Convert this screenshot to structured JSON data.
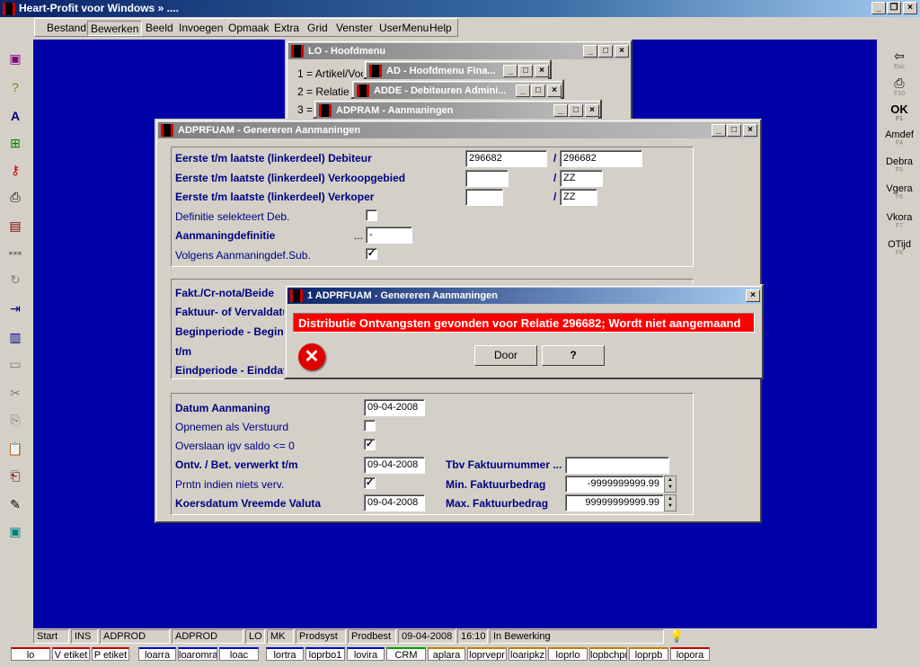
{
  "app": {
    "title": "Heart-Profit voor Windows",
    "title_suffix": "»  ...."
  },
  "menubar": {
    "items": [
      "Bestand",
      "Bewerken",
      "Beeld",
      "Invoegen",
      "Opmaak",
      "Extra",
      "Grid",
      "Venster",
      "UserMenu",
      "Help"
    ]
  },
  "right_toolbar": [
    {
      "label": "",
      "key": "Esc",
      "icon": "back-arrow-icon"
    },
    {
      "label": "",
      "key": "F10",
      "icon": "print-icon"
    },
    {
      "label": "OK",
      "key": "F1"
    },
    {
      "label": "Amdef",
      "key": "F4"
    },
    {
      "label": "Debra",
      "key": "F5"
    },
    {
      "label": "Vgera",
      "key": "F6"
    },
    {
      "label": "Vkora",
      "key": "F7"
    },
    {
      "label": "OTijd",
      "key": "F8"
    }
  ],
  "lo_window": {
    "title": "LO - Hoofdmenu",
    "items": [
      "1 = Artikel/Voo",
      "2 = Relatie",
      "3 ="
    ]
  },
  "ad_window": {
    "title": "AD - Hoofdmenu Fina..."
  },
  "adde_window": {
    "title": "ADDE - Debiteuren Admini..."
  },
  "adpram_window": {
    "title": "ADPRAM - Aanmaningen"
  },
  "main_window": {
    "title": "ADPRFUAM - Genereren Aanmaningen",
    "group1": {
      "debiteur_label": "Eerste t/m laatste (linkerdeel) Debiteur",
      "debiteur_from": "296682",
      "debiteur_to": "296682",
      "verkoopgebied_label": "Eerste t/m laatste (linkerdeel) Verkoopgebied",
      "verkoopgebied_from": "",
      "verkoopgebied_to": "ZZ",
      "verkoper_label": "Eerste t/m laatste (linkerdeel) Verkoper",
      "verkoper_from": "",
      "verkoper_to": "ZZ",
      "definitie_label": "Definitie selekteert Deb.",
      "definitie_checked": false,
      "aanmaningdef_label": "Aanmaningdefinitie",
      "aanmaningdef_value": "-",
      "aanmaningdef_dots": "...",
      "volgens_label": "Volgens Aanmaningdef.Sub.",
      "volgens_checked": true,
      "slash": "/"
    },
    "group2": {
      "fakt_label": "Fakt./Cr-nota/Beide",
      "faktuur_label": "Faktuur- of Vervaldatu",
      "beginperiode_label": "Beginperiode - Begin",
      "tm_label": "t/m",
      "eindperiode_label": "Eindperiode  - Einddat"
    },
    "group3": {
      "datum_label": "Datum Aanmaning",
      "datum_value": "09-04-2008",
      "opnemen_label": "Opnemen als Verstuurd",
      "opnemen_checked": false,
      "overslaan_label": "Overslaan igv saldo <= 0",
      "overslaan_checked": true,
      "ontv_label": "Ontv. / Bet. verwerkt t/m",
      "ontv_value": "09-04-2008",
      "prntn_label": "Prntn indien niets verv.",
      "prntn_checked": true,
      "koers_label": "Koersdatum Vreemde Valuta",
      "koers_value": "09-04-2008",
      "tbv_label": "Tbv  Faktuurnummer ...",
      "tbv_value": "",
      "min_label": "Min. Faktuurbedrag",
      "min_value": "-9999999999.99",
      "max_label": "Max. Faktuurbedrag",
      "max_value": "99999999999.99"
    }
  },
  "dialog": {
    "title": "1 ADPRFUAM - Genereren Aanmaningen",
    "message": "Distributie Ontvangsten gevonden voor Relatie 296682; Wordt niet aangemaand",
    "message_bg": "#ff0000",
    "door_button": "Door",
    "help_button": "?"
  },
  "statusbar": [
    "Start",
    "INS",
    "ADPROD",
    "ADPROD",
    "LO",
    "MK",
    "Prodsyst",
    "Prodbest",
    "09-04-2008",
    "16:10",
    "In Bewerking"
  ],
  "taskbar": [
    "lo",
    "V etiket",
    "P etiket",
    "loarra",
    "loaromra",
    "loac",
    "lortra",
    "loprbo1",
    "lovira",
    "CRM",
    "aplara",
    "loprvepr",
    "loaripkz",
    "loprlo",
    "lopbchpr",
    "loprpb",
    "lopora"
  ]
}
